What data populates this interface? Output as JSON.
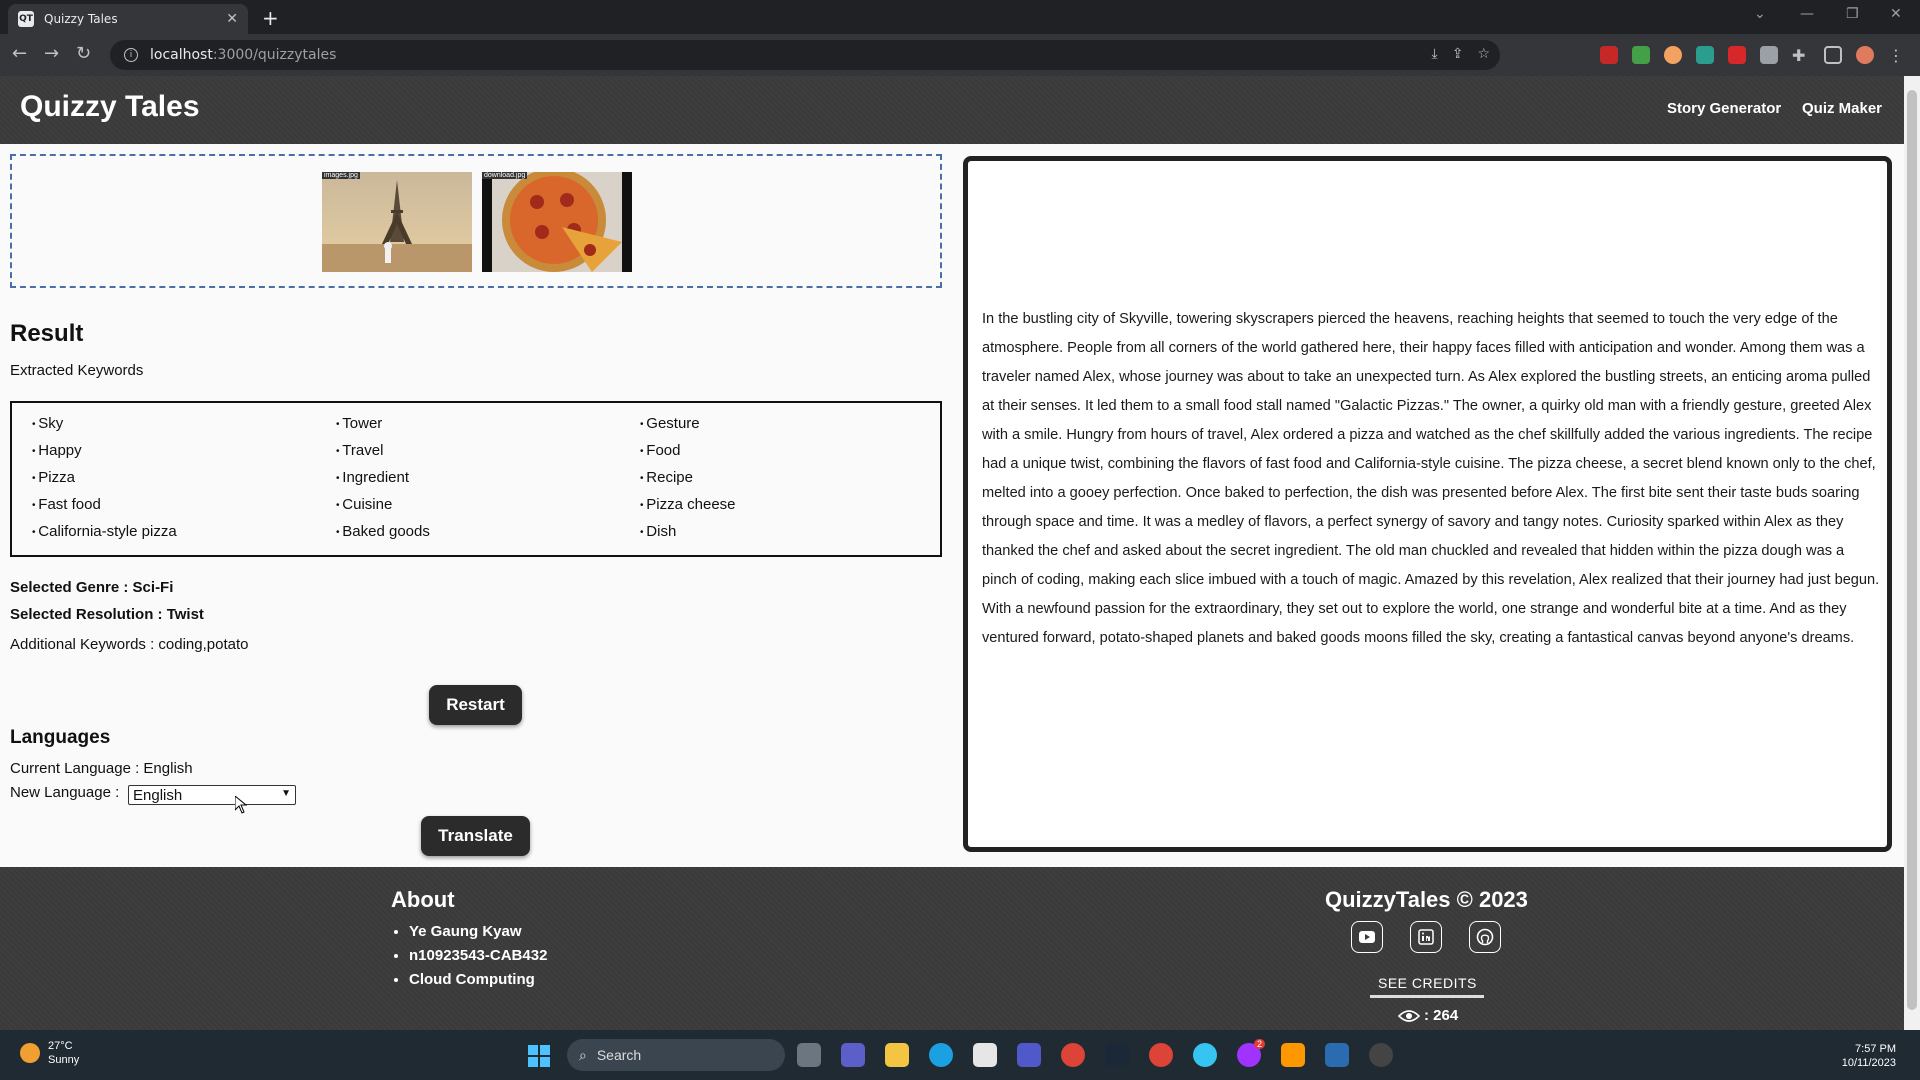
{
  "browser": {
    "tab_title": "Quizzy Tales",
    "url_host": "localhost",
    "url_path": ":3000/quizzytales"
  },
  "header": {
    "brand": "Quizzy Tales",
    "nav": [
      "Story Generator",
      "Quiz Maker"
    ]
  },
  "uploads": [
    {
      "label": "images.jpg",
      "icon": "eiffel-tower-image"
    },
    {
      "label": "download.jpg",
      "icon": "pizza-image"
    }
  ],
  "result": {
    "heading": "Result",
    "keywords_label": "Extracted Keywords",
    "keywords": [
      "Sky",
      "Tower",
      "Gesture",
      "Happy",
      "Travel",
      "Food",
      "Pizza",
      "Ingredient",
      "Recipe",
      "Fast food",
      "Cuisine",
      "Pizza cheese",
      "California-style pizza",
      "Baked goods",
      "Dish"
    ],
    "genre": "Selected Genre : Sci-Fi",
    "resolution": "Selected Resolution : Twist",
    "additional": "Additional Keywords : coding,potato",
    "restart_label": "Restart"
  },
  "languages": {
    "heading": "Languages",
    "current": "Current Language : English",
    "new_label": "New Language :",
    "selected": "English",
    "translate_label": "Translate"
  },
  "story": {
    "text": "In the bustling city of Skyville, towering skyscrapers pierced the heavens, reaching heights that seemed to touch the very edge of the atmosphere. People from all corners of the world gathered here, their happy faces filled with anticipation and wonder. Among them was a traveler named Alex, whose journey was about to take an unexpected turn. As Alex explored the bustling streets, an enticing aroma pulled at their senses. It led them to a small food stall named \"Galactic Pizzas.\" The owner, a quirky old man with a friendly gesture, greeted Alex with a smile. Hungry from hours of travel, Alex ordered a pizza and watched as the chef skillfully added the various ingredients. The recipe had a unique twist, combining the flavors of fast food and California-style cuisine. The pizza cheese, a secret blend known only to the chef, melted into a gooey perfection. Once baked to perfection, the dish was presented before Alex. The first bite sent their taste buds soaring through space and time. It was a medley of flavors, a perfect synergy of savory and tangy notes. Curiosity sparked within Alex as they thanked the chef and asked about the secret ingredient. The old man chuckled and revealed that hidden within the pizza dough was a pinch of coding, making each slice imbued with a touch of magic. Amazed by this revelation, Alex realized that their journey had just begun. With a newfound passion for the extraordinary, they set out to explore the world, one strange and wonderful bite at a time. And as they ventured forward, potato-shaped planets and baked goods moons filled the sky, creating a fantastical canvas beyond anyone's dreams."
  },
  "footer": {
    "about_heading": "About",
    "about_items": [
      "Ye Gaung Kyaw",
      "n10923543-CAB432",
      "Cloud Computing"
    ],
    "copyright": "QuizzyTales © 2023",
    "social_icons": [
      "youtube-icon",
      "linkedin-icon",
      "github-icon"
    ],
    "credits_label": "SEE CREDITS",
    "views": ": 264"
  },
  "taskbar": {
    "temp": "27°C",
    "weather": "Sunny",
    "search_placeholder": "Search",
    "time": "7:57 PM",
    "date": "10/11/2023",
    "badge": "2"
  }
}
